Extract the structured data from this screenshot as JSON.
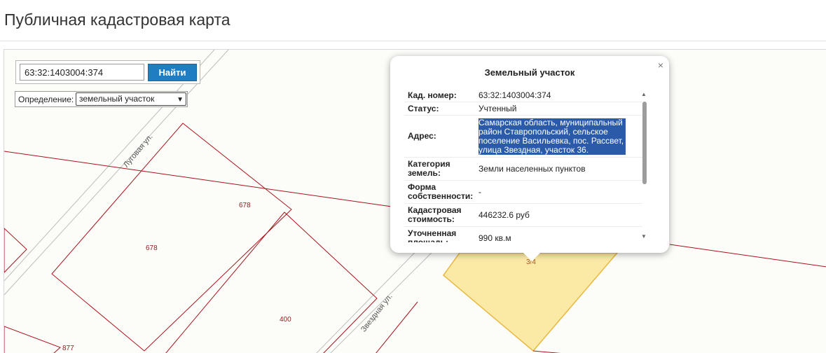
{
  "page": {
    "title": "Публичная кадастровая карта"
  },
  "search": {
    "value": "63:32:1403004:374",
    "button_label": "Найти"
  },
  "definition": {
    "label": "Определение:",
    "selected": "земельный участок"
  },
  "map": {
    "parcel_labels": [
      "678",
      "678",
      "400",
      "877",
      "3/4",
      "400"
    ],
    "streets": [
      "Луговая ул.",
      "Звездная ул."
    ],
    "colors": {
      "parcel_border": "#a8131b",
      "selected_fill": "#fbe9a6",
      "selected_border": "#e8b842",
      "road": "#b5b5b5"
    }
  },
  "popup": {
    "title": "Земельный участок",
    "close": "×",
    "rows": [
      {
        "key": "Кад. номер:",
        "value": "63:32:1403004:374"
      },
      {
        "key": "Статус:",
        "value": "Учтенный"
      },
      {
        "key": "Адрес:",
        "value": "Самарская область, муниципальный район Ставропольский, сельское поселение Васильевка, пос. Рассвет, улица Звездная, участок 36."
      },
      {
        "key": "Категория земель:",
        "value": "Земли населенных пунктов"
      },
      {
        "key": "Форма собственности:",
        "value": "-"
      },
      {
        "key": "Кадастровая стоимость:",
        "value": "446232.6 руб"
      },
      {
        "key": "Уточненная площадь:",
        "value": "990 кв.м"
      }
    ]
  }
}
